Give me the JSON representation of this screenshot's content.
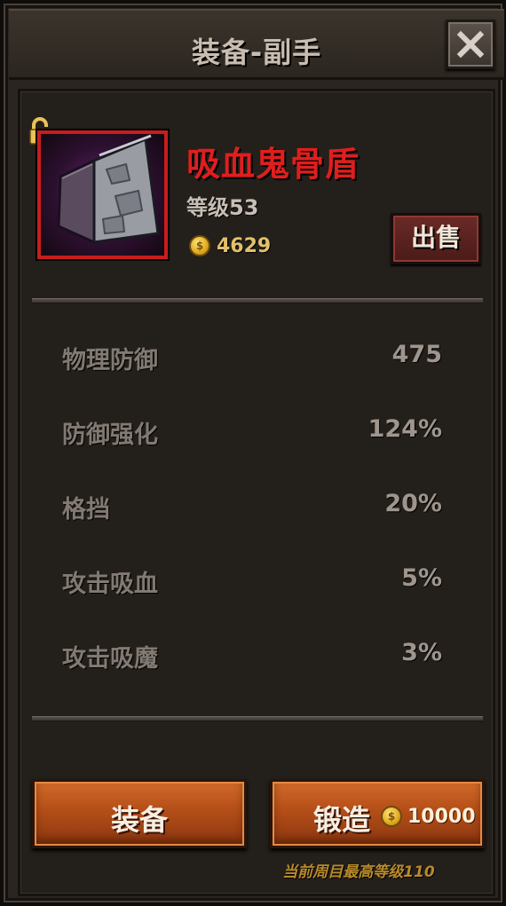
{
  "window": {
    "title": "装备-副手"
  },
  "item": {
    "name": "吸血鬼骨盾",
    "level": "等级53",
    "price": "4629",
    "sell_label": "出售"
  },
  "stats": [
    {
      "label": "物理防御",
      "value": "475"
    },
    {
      "label": "防御强化",
      "value": "124%"
    },
    {
      "label": "格挡",
      "value": "20%"
    },
    {
      "label": "攻击吸血",
      "value": "5%"
    },
    {
      "label": "攻击吸魔",
      "value": "3%"
    }
  ],
  "actions": {
    "equip_label": "装备",
    "forge_label": "锻造",
    "forge_cost": "10000"
  },
  "footer_note": "当前周目最高等级110",
  "colors": {
    "item_name": "#e01e1e",
    "item_frame": "#c81d1d",
    "gold": "#e2c06a",
    "button_orange": "#b44e18"
  }
}
